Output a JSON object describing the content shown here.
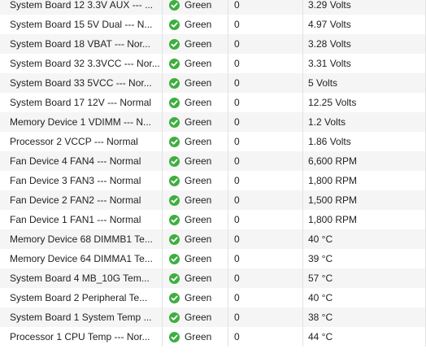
{
  "rows": [
    {
      "name": "System Board 12 3.3V AUX --- ...",
      "status": "Green",
      "count": "0",
      "value": "3.29 Volts"
    },
    {
      "name": "System Board 15 5V Dual --- N...",
      "status": "Green",
      "count": "0",
      "value": "4.97 Volts"
    },
    {
      "name": "System Board 18 VBAT --- Nor...",
      "status": "Green",
      "count": "0",
      "value": "3.28 Volts"
    },
    {
      "name": "System Board 32 3.3VCC --- Nor...",
      "status": "Green",
      "count": "0",
      "value": "3.31 Volts"
    },
    {
      "name": "System Board 33 5VCC --- Nor...",
      "status": "Green",
      "count": "0",
      "value": "5 Volts"
    },
    {
      "name": "System Board 17 12V --- Normal",
      "status": "Green",
      "count": "0",
      "value": "12.25 Volts"
    },
    {
      "name": "Memory Device 1 VDIMM --- N...",
      "status": "Green",
      "count": "0",
      "value": "1.2 Volts"
    },
    {
      "name": "Processor 2 VCCP --- Normal",
      "status": "Green",
      "count": "0",
      "value": "1.86 Volts"
    },
    {
      "name": "Fan Device 4 FAN4 --- Normal",
      "status": "Green",
      "count": "0",
      "value": "6,600 RPM"
    },
    {
      "name": "Fan Device 3 FAN3 --- Normal",
      "status": "Green",
      "count": "0",
      "value": "1,800 RPM"
    },
    {
      "name": "Fan Device 2 FAN2 --- Normal",
      "status": "Green",
      "count": "0",
      "value": "1,500 RPM"
    },
    {
      "name": "Fan Device 1 FAN1 --- Normal",
      "status": "Green",
      "count": "0",
      "value": "1,800 RPM"
    },
    {
      "name": "Memory Device 68 DIMMB1 Te...",
      "status": "Green",
      "count": "0",
      "value": "40 °C"
    },
    {
      "name": "Memory Device 64 DIMMA1 Te...",
      "status": "Green",
      "count": "0",
      "value": "39 °C"
    },
    {
      "name": "System Board 4 MB_10G Tem...",
      "status": "Green",
      "count": "0",
      "value": "57 °C"
    },
    {
      "name": "System Board 2 Peripheral Te...",
      "status": "Green",
      "count": "0",
      "value": "40 °C"
    },
    {
      "name": "System Board 1 System Temp ...",
      "status": "Green",
      "count": "0",
      "value": "38 °C"
    },
    {
      "name": "Processor 1 CPU Temp --- Nor...",
      "status": "Green",
      "count": "0",
      "value": "44 °C"
    }
  ],
  "status_icon": "check-circle-icon",
  "colors": {
    "status_green": "#3fae3f",
    "row_alt": "#f5f5f5"
  }
}
